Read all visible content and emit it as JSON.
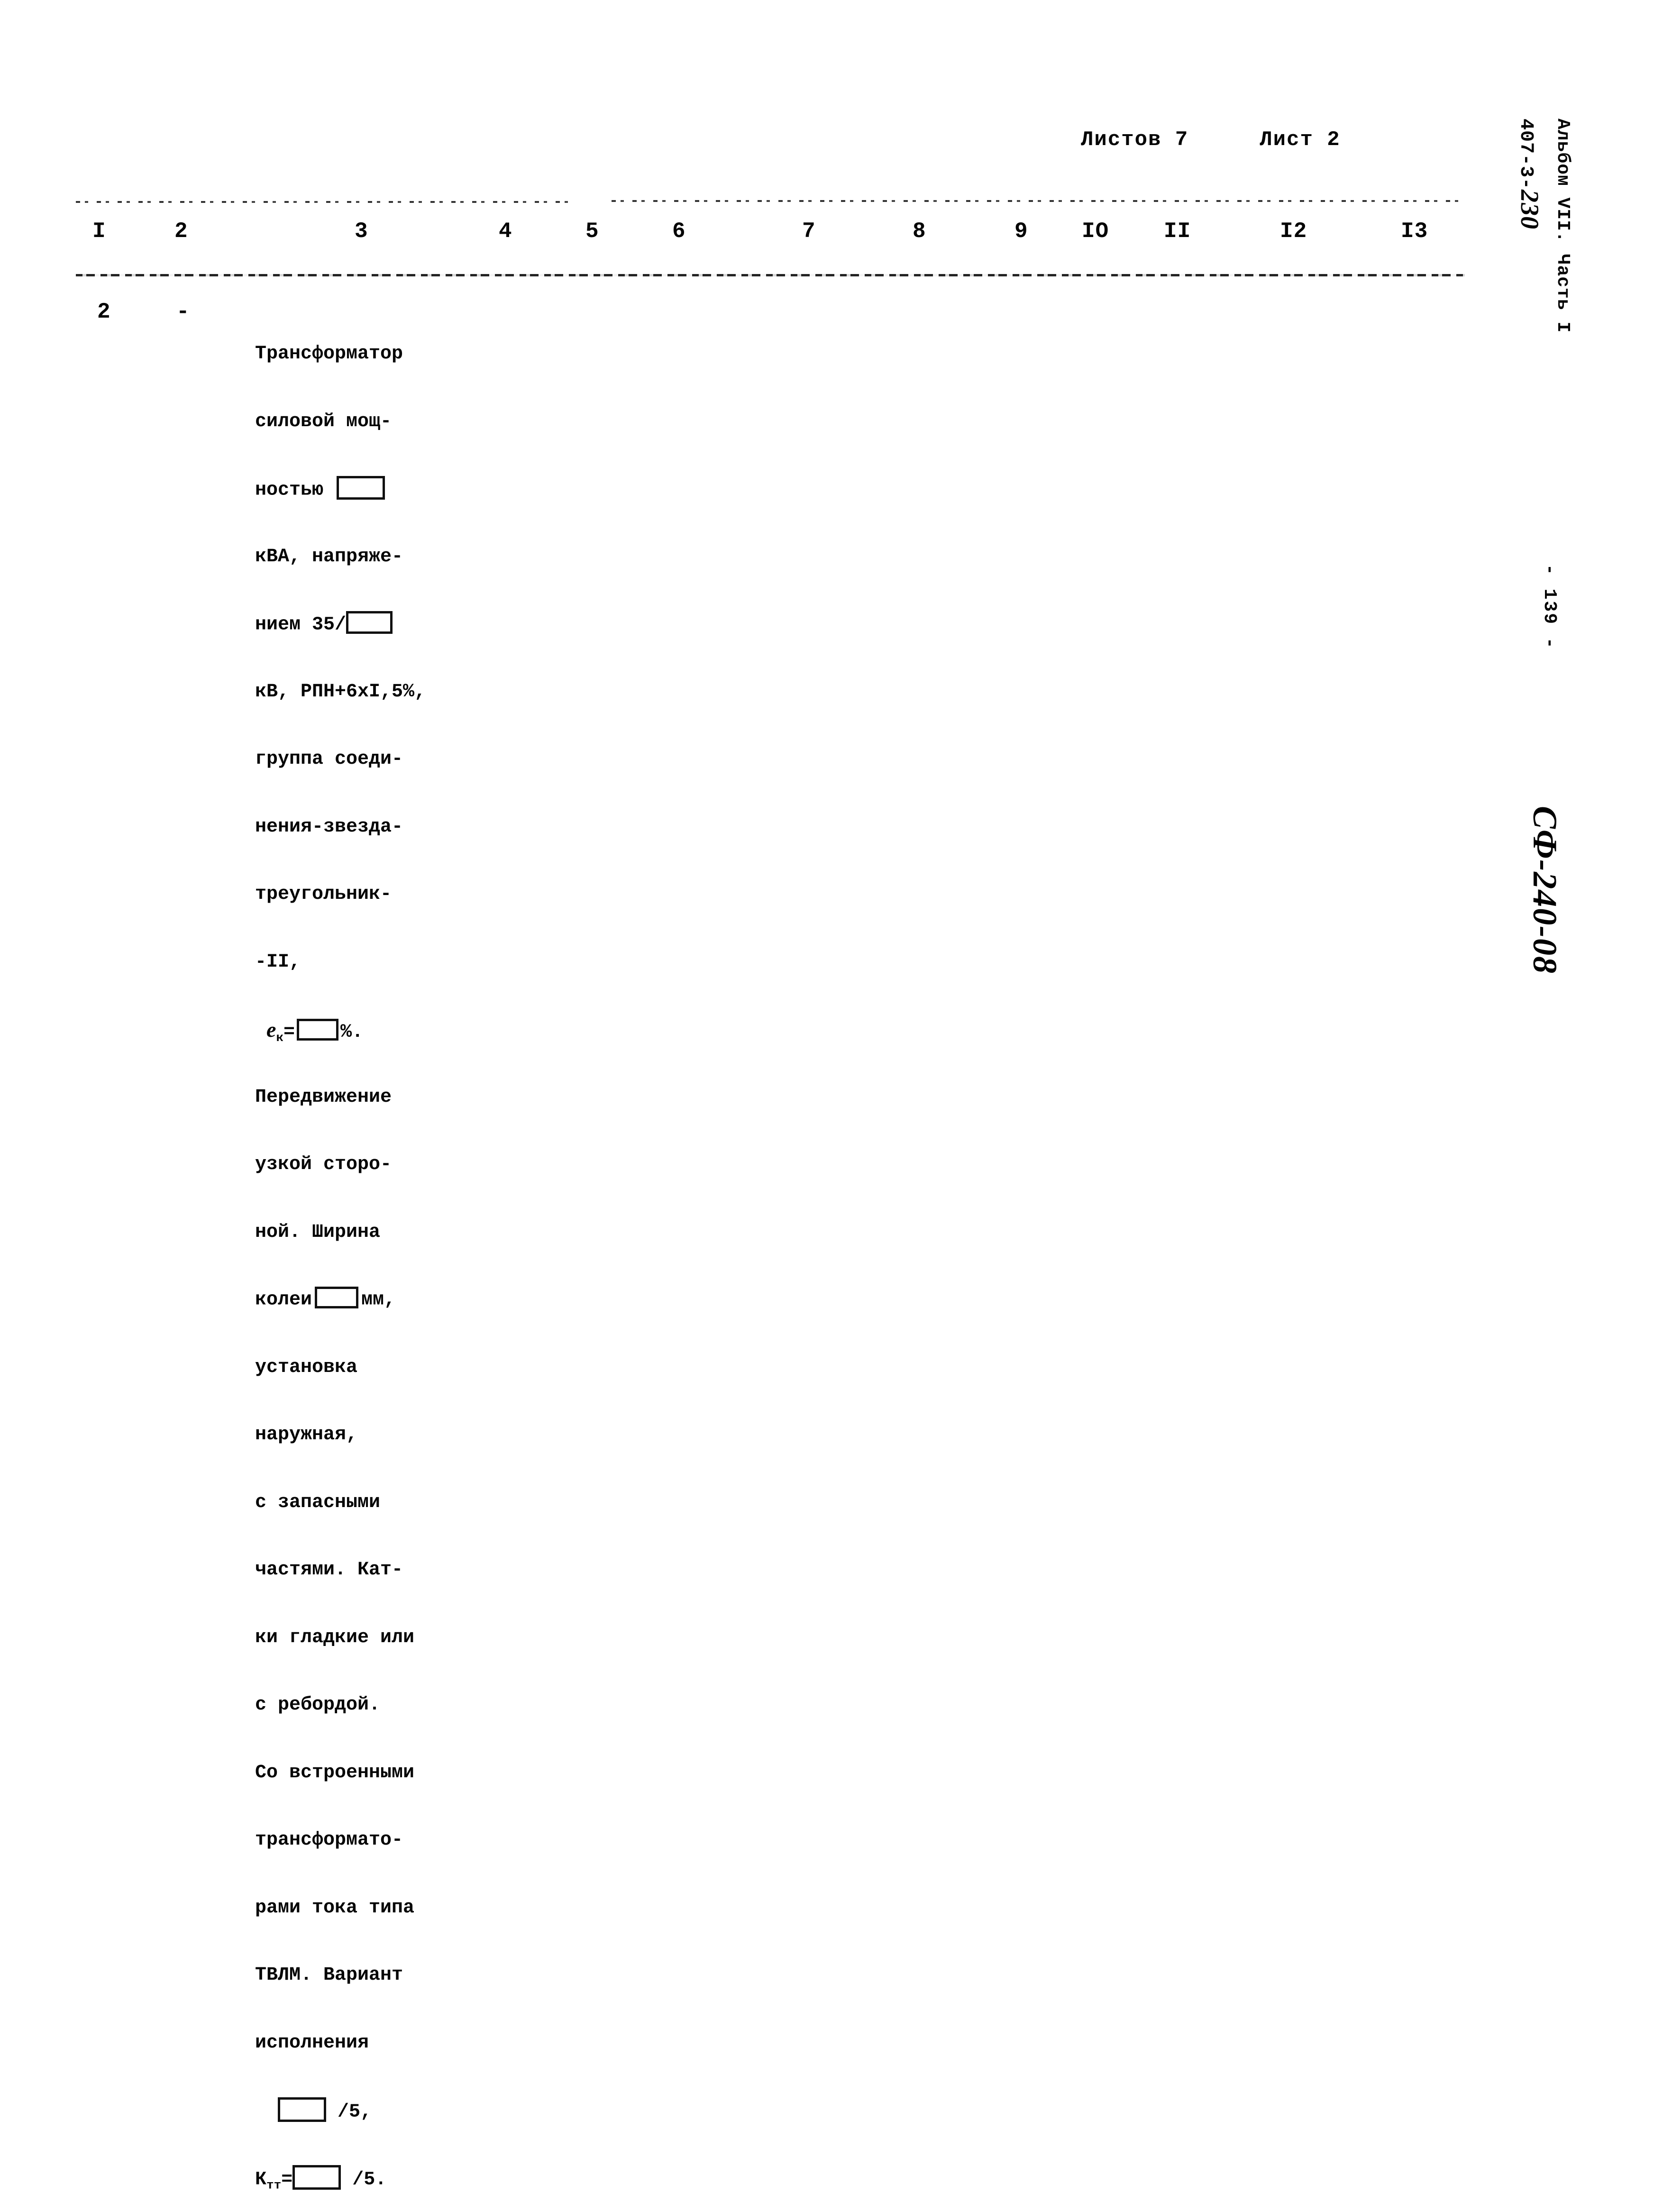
{
  "header": {
    "sheets_total_label": "Листов 7",
    "sheet_current_label": "Лист 2"
  },
  "table": {
    "column_headers": [
      "I",
      "2",
      "3",
      "4",
      "5",
      "6",
      "7",
      "8",
      "9",
      "IO",
      "II",
      "I2",
      "I3"
    ],
    "row": {
      "col1_position_number": "2",
      "col2_value": "-",
      "col3_description_lines": [
        "Трансформатор",
        "силовой мощ-",
        "ностью",
        "кВА, напряже-",
        "нием 35/",
        "кВ, РПН+6хI,5%,",
        "группа соеди-",
        "нения-звезда-",
        "треугольник-",
        "-II,",
        "ек=        %.",
        "Передвижение",
        "узкой сторо-",
        "ной. Ширина",
        "колеи        мм,",
        "установка",
        "наружная,",
        "с запасными",
        "частями. Кат-",
        "ки гладкие или",
        "с ребордой.",
        "Со встроенными",
        "трансформато-",
        "рами тока типа",
        "ТВЛМ. Вариант",
        "исполнения",
        "/5,",
        "/5."
      ]
    }
  },
  "body_text": {
    "l1": "Трансформатор",
    "l2": "силовой мощ-",
    "l3_pre": "ностью ",
    "l4_pre": "кВА, напряже-",
    "l5_pre": "нием 35/",
    "l6": "кВ, РПН+6хI,5%,",
    "l7": "группа соеди-",
    "l8": "нения-звезда-",
    "l9": "треугольник-",
    "l10": "-II,",
    "l11_e": "e",
    "l11_sub": "к",
    "l11_eq": "=",
    "l11_pct": "%.",
    "l12": "Передвижение",
    "l13": "узкой сторо-",
    "l14": "ной. Ширина",
    "l15_pre": "колеи",
    "l15_post": "мм,",
    "l16": "установка",
    "l17": "наружная,",
    "l18": "с запасными",
    "l19": "частями. Кат-",
    "l20": "ки гладкие или",
    "l21": "с ребордой.",
    "l22": "Со встроенными",
    "l23": "трансформато-",
    "l24": "рами тока типа",
    "l25": "ТВЛМ. Вариант",
    "l26": "исполнения",
    "l27_post": "/5,",
    "l28_k": "К",
    "l28_sub": "тт",
    "l28_eq": "=",
    "l28_post": "/5."
  },
  "margin": {
    "album_code_typed": "407-3-",
    "album_code_hand": "230",
    "album_part": "Альбом VII. Часть I",
    "page_number": "- 139 -",
    "doc_code": "СФ-240-08"
  },
  "colors": {
    "ink": "#0a0a0a",
    "paper": "#ffffff"
  }
}
